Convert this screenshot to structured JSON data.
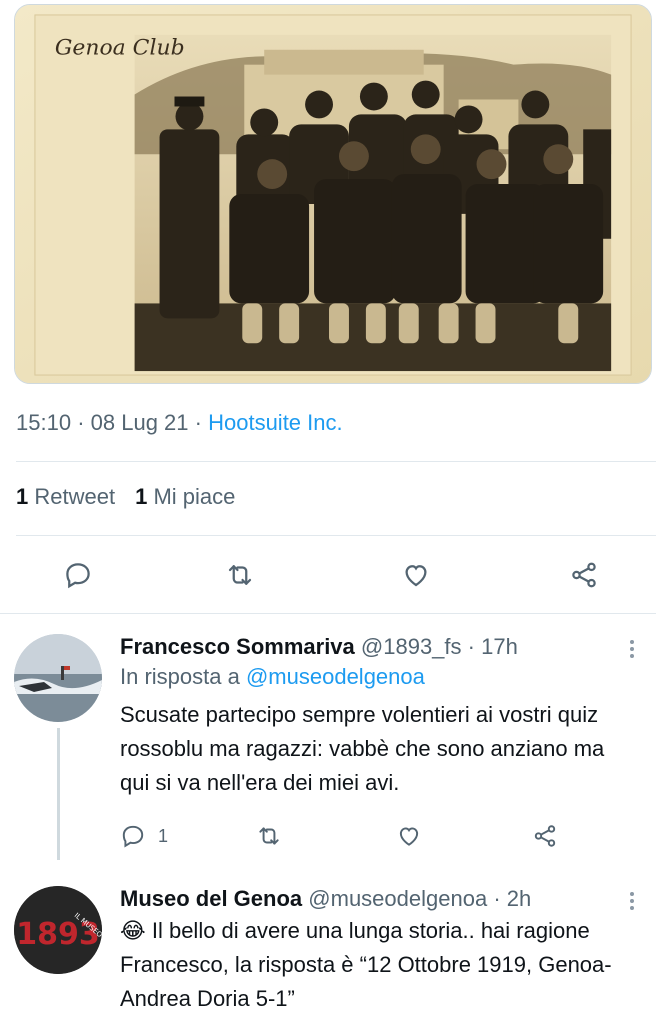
{
  "media": {
    "alt_icon": "vintage-team-photo",
    "caption_script": "Genoa Club"
  },
  "tweet_meta": {
    "time": "15:10",
    "date": "08 Lug 21",
    "source": "Hootsuite Inc.",
    "separator": "·"
  },
  "stats": {
    "retweets_count": "1",
    "retweets_label": "Retweet",
    "likes_count": "1",
    "likes_label": "Mi piace"
  },
  "actions": {
    "reply_icon": "reply-icon",
    "retweet_icon": "retweet-icon",
    "like_icon": "heart-icon",
    "share_icon": "share-icon"
  },
  "replies": [
    {
      "name": "Francesco Sommariva",
      "handle": "@1893_fs",
      "time": "17h",
      "replying_prefix": "In risposta a",
      "replying_to": "@museodelgenoa",
      "text": "Scusate partecipo sempre volentieri ai vostri quiz rossoblu ma ragazzi: vabbè che sono anziano ma qui si va nell'era dei miei avi.",
      "reply_count": "1"
    },
    {
      "name": "Museo del Genoa",
      "handle": "@museodelgenoa",
      "time": "2h",
      "emoji": "😂",
      "text": "Il bello di avere una lunga storia.. hai ragione Francesco, la risposta è “12 Ottobre 1919, Genoa-Andrea Doria 5-1”",
      "avatar_text": "IL MUSEO DEL GENOA",
      "avatar_digits": "1893"
    }
  ],
  "colors": {
    "accent": "#1d9bf0",
    "muted": "#536471",
    "border": "#cfd9de"
  }
}
